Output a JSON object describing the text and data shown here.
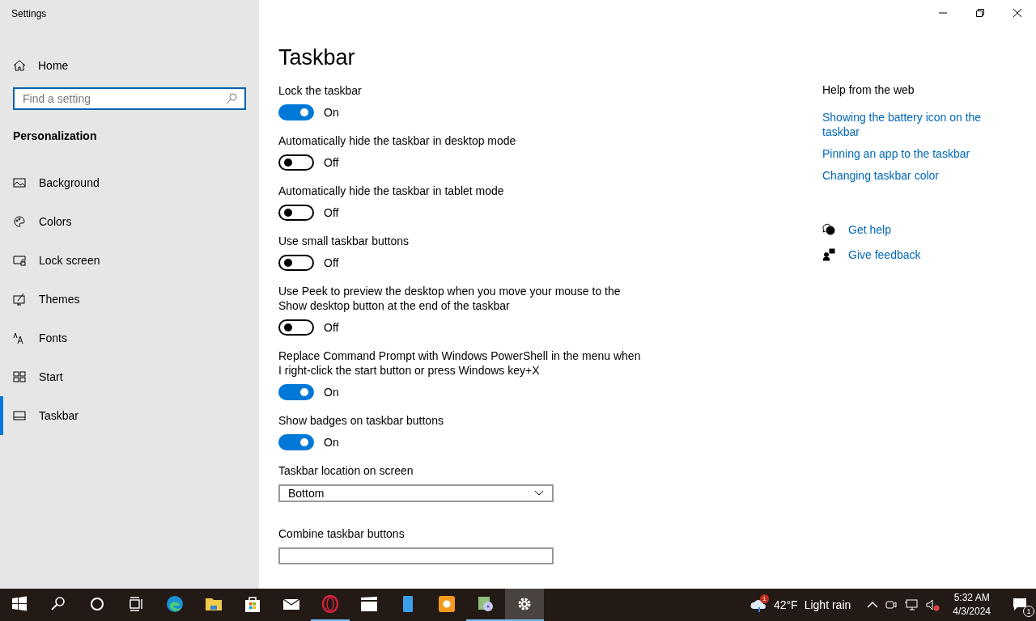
{
  "window": {
    "title": "Settings"
  },
  "sidebar": {
    "home": "Home",
    "search": {
      "placeholder": "Find a setting"
    },
    "section": "Personalization",
    "items": [
      {
        "label": "Background",
        "selected": false
      },
      {
        "label": "Colors",
        "selected": false
      },
      {
        "label": "Lock screen",
        "selected": false
      },
      {
        "label": "Themes",
        "selected": false
      },
      {
        "label": "Fonts",
        "selected": false
      },
      {
        "label": "Start",
        "selected": false
      },
      {
        "label": "Taskbar",
        "selected": true
      }
    ]
  },
  "page": {
    "title": "Taskbar",
    "settings": [
      {
        "kind": "toggle",
        "label": "Lock the taskbar",
        "on": true,
        "state": "On"
      },
      {
        "kind": "toggle",
        "label": "Automatically hide the taskbar in desktop mode",
        "on": false,
        "state": "Off"
      },
      {
        "kind": "toggle",
        "label": "Automatically hide the taskbar in tablet mode",
        "on": false,
        "state": "Off"
      },
      {
        "kind": "toggle",
        "label": "Use small taskbar buttons",
        "on": false,
        "state": "Off"
      },
      {
        "kind": "toggle",
        "label": "Use Peek to preview the desktop when you move your mouse to the Show desktop button at the end of the taskbar",
        "on": false,
        "state": "Off"
      },
      {
        "kind": "toggle",
        "label": "Replace Command Prompt with Windows PowerShell in the menu when I right-click the start button or press Windows key+X",
        "on": true,
        "state": "On"
      },
      {
        "kind": "toggle",
        "label": "Show badges on taskbar buttons",
        "on": true,
        "state": "On"
      },
      {
        "kind": "dropdown",
        "label": "Taskbar location on screen",
        "value": "Bottom"
      },
      {
        "kind": "dropdown",
        "label": "Combine taskbar buttons"
      }
    ]
  },
  "help": {
    "title": "Help from the web",
    "links": [
      "Showing the battery icon on the taskbar",
      "Pinning an app to the taskbar",
      "Changing taskbar color"
    ],
    "actions": [
      "Get help",
      "Give feedback"
    ]
  },
  "taskbar": {
    "apps": [
      {
        "running": false,
        "active": false
      },
      {
        "running": false,
        "active": false
      },
      {
        "running": false,
        "active": false
      },
      {
        "running": false,
        "active": false
      },
      {
        "running": false,
        "active": false
      },
      {
        "running": false,
        "active": false
      },
      {
        "running": false,
        "active": false
      },
      {
        "running": false,
        "active": false
      },
      {
        "running": true,
        "active": false
      },
      {
        "running": false,
        "active": false
      },
      {
        "running": false,
        "active": false
      },
      {
        "running": false,
        "active": false
      },
      {
        "running": true,
        "active": false
      },
      {
        "running": true,
        "active": true
      }
    ],
    "weather": {
      "badge": "1",
      "temp": "42°F",
      "condition": "Light rain"
    },
    "time": "5:32 AM",
    "date": "4/3/2024",
    "notifications": "1"
  }
}
